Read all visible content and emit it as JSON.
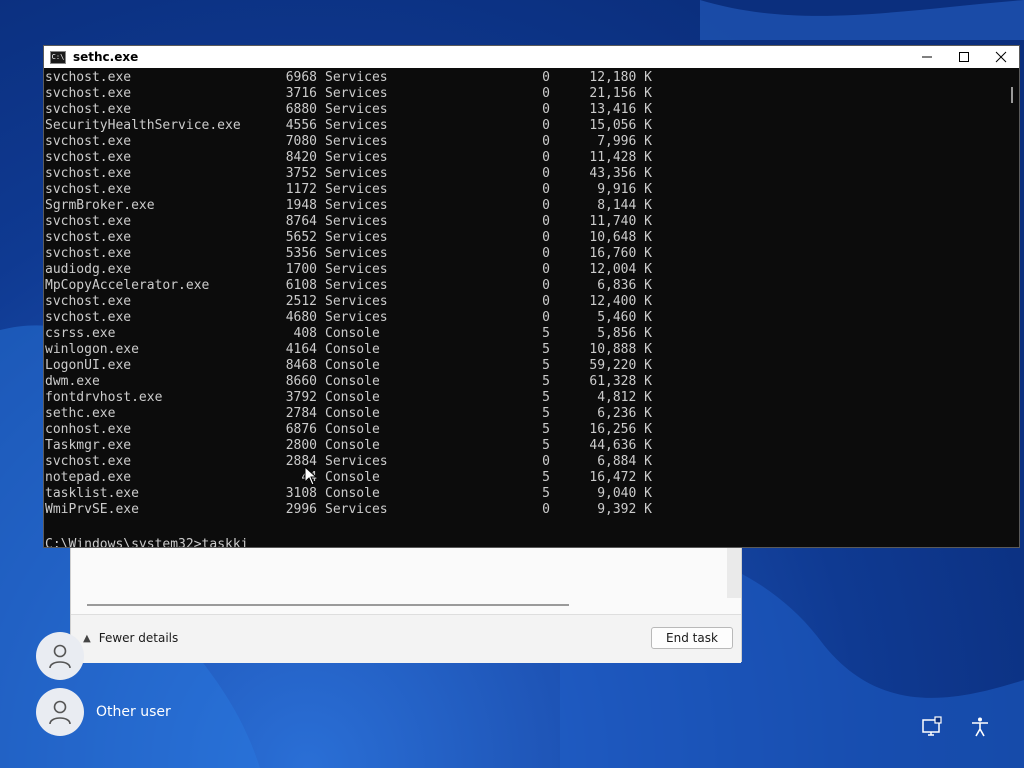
{
  "console": {
    "title": "sethc.exe",
    "icon_text": "C:\\",
    "rows": [
      {
        "name": "svchost.exe",
        "pid": "6968",
        "session": "Services",
        "num": "0",
        "mem": "12,180 K"
      },
      {
        "name": "svchost.exe",
        "pid": "3716",
        "session": "Services",
        "num": "0",
        "mem": "21,156 K"
      },
      {
        "name": "svchost.exe",
        "pid": "6880",
        "session": "Services",
        "num": "0",
        "mem": "13,416 K"
      },
      {
        "name": "SecurityHealthService.exe",
        "pid": "4556",
        "session": "Services",
        "num": "0",
        "mem": "15,056 K"
      },
      {
        "name": "svchost.exe",
        "pid": "7080",
        "session": "Services",
        "num": "0",
        "mem": "7,996 K"
      },
      {
        "name": "svchost.exe",
        "pid": "8420",
        "session": "Services",
        "num": "0",
        "mem": "11,428 K"
      },
      {
        "name": "svchost.exe",
        "pid": "3752",
        "session": "Services",
        "num": "0",
        "mem": "43,356 K"
      },
      {
        "name": "svchost.exe",
        "pid": "1172",
        "session": "Services",
        "num": "0",
        "mem": "9,916 K"
      },
      {
        "name": "SgrmBroker.exe",
        "pid": "1948",
        "session": "Services",
        "num": "0",
        "mem": "8,144 K"
      },
      {
        "name": "svchost.exe",
        "pid": "8764",
        "session": "Services",
        "num": "0",
        "mem": "11,740 K"
      },
      {
        "name": "svchost.exe",
        "pid": "5652",
        "session": "Services",
        "num": "0",
        "mem": "10,648 K"
      },
      {
        "name": "svchost.exe",
        "pid": "5356",
        "session": "Services",
        "num": "0",
        "mem": "16,760 K"
      },
      {
        "name": "audiodg.exe",
        "pid": "1700",
        "session": "Services",
        "num": "0",
        "mem": "12,004 K"
      },
      {
        "name": "MpCopyAccelerator.exe",
        "pid": "6108",
        "session": "Services",
        "num": "0",
        "mem": "6,836 K"
      },
      {
        "name": "svchost.exe",
        "pid": "2512",
        "session": "Services",
        "num": "0",
        "mem": "12,400 K"
      },
      {
        "name": "svchost.exe",
        "pid": "4680",
        "session": "Services",
        "num": "0",
        "mem": "5,460 K"
      },
      {
        "name": "csrss.exe",
        "pid": "408",
        "session": "Console",
        "num": "5",
        "mem": "5,856 K"
      },
      {
        "name": "winlogon.exe",
        "pid": "4164",
        "session": "Console",
        "num": "5",
        "mem": "10,888 K"
      },
      {
        "name": "LogonUI.exe",
        "pid": "8468",
        "session": "Console",
        "num": "5",
        "mem": "59,220 K"
      },
      {
        "name": "dwm.exe",
        "pid": "8660",
        "session": "Console",
        "num": "5",
        "mem": "61,328 K"
      },
      {
        "name": "fontdrvhost.exe",
        "pid": "3792",
        "session": "Console",
        "num": "5",
        "mem": "4,812 K"
      },
      {
        "name": "sethc.exe",
        "pid": "2784",
        "session": "Console",
        "num": "5",
        "mem": "6,236 K"
      },
      {
        "name": "conhost.exe",
        "pid": "6876",
        "session": "Console",
        "num": "5",
        "mem": "16,256 K"
      },
      {
        "name": "Taskmgr.exe",
        "pid": "2800",
        "session": "Console",
        "num": "5",
        "mem": "44,636 K"
      },
      {
        "name": "svchost.exe",
        "pid": "2884",
        "session": "Services",
        "num": "0",
        "mem": "6,884 K"
      },
      {
        "name": "notepad.exe",
        "pid": "44",
        "session": "Console",
        "num": "5",
        "mem": "16,472 K"
      },
      {
        "name": "tasklist.exe",
        "pid": "3108",
        "session": "Console",
        "num": "5",
        "mem": "9,040 K"
      },
      {
        "name": "WmiPrvSE.exe",
        "pid": "2996",
        "session": "Services",
        "num": "0",
        "mem": "9,392 K"
      }
    ],
    "prompt": "C:\\Windows\\system32>",
    "typed": "taskki"
  },
  "task_manager": {
    "fewer_details_label": "Fewer details",
    "end_task_label": "End task"
  },
  "users": {
    "other_user_label": "Other user"
  },
  "icons": {
    "network": "network-icon",
    "accessibility": "accessibility-icon"
  }
}
